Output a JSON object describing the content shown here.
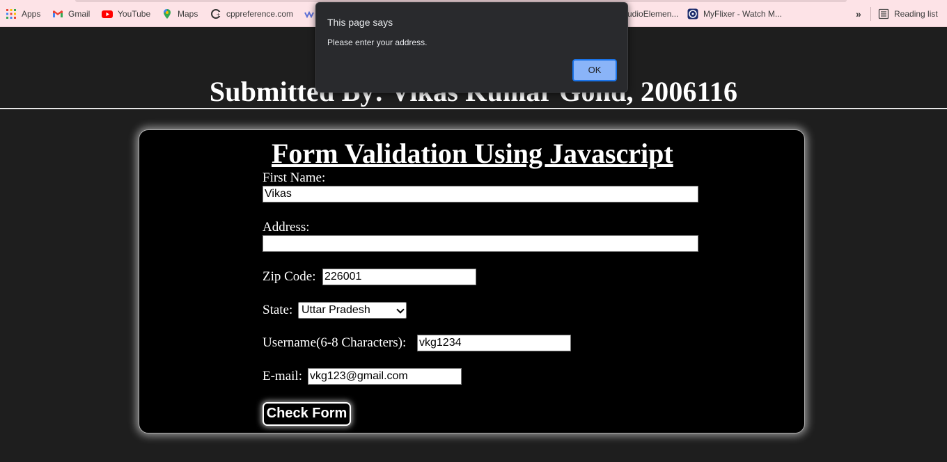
{
  "bookmarks": {
    "items": [
      {
        "label": "Apps",
        "icon": "apps-grid-icon"
      },
      {
        "label": "Gmail",
        "icon": "gmail-icon"
      },
      {
        "label": "YouTube",
        "icon": "youtube-icon"
      },
      {
        "label": "Maps",
        "icon": "maps-pin-icon"
      },
      {
        "label": "cppreference.com",
        "icon": "cppreference-icon"
      },
      {
        "label": "udioElemen...",
        "icon": ""
      },
      {
        "label": "MyFlixer - Watch M...",
        "icon": "myflixer-icon"
      }
    ],
    "overflow_label": "»",
    "reading_list_label": "Reading list"
  },
  "page": {
    "submitted_by": "Submitted By: Vikas Kumar Gond, 2006116"
  },
  "form": {
    "title": "Form Validation Using Javascript",
    "first_name_label": "First Name:",
    "first_name_value": "Vikas",
    "address_label": "Address:",
    "address_value": "",
    "zip_label": "Zip Code:",
    "zip_value": "226001",
    "state_label": "State:",
    "state_value": "Uttar Pradesh",
    "username_label": "Username(6-8 Characters):",
    "username_value": "vkg1234",
    "email_label": "E-mail:",
    "email_value": "vkg123@gmail.com",
    "submit_label": "Check Form"
  },
  "dialog": {
    "title": "This page says",
    "message": "Please enter your address.",
    "ok_label": "OK"
  },
  "colors": {
    "background": "#1e1e1e",
    "card": "#000000",
    "bookmarks_bar": "#fde3e7",
    "dialog": "#292a2d",
    "ok_button": "#8ab4f8"
  }
}
